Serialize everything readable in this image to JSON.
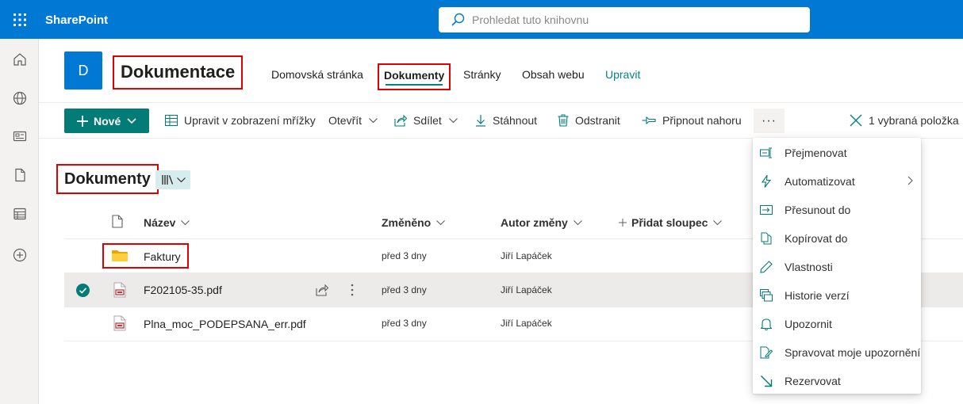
{
  "app": {
    "name": "SharePoint"
  },
  "search": {
    "placeholder": "Prohledat tuto knihovnu"
  },
  "site": {
    "logo_letter": "D",
    "title": "Dokumentace"
  },
  "nav": {
    "items": [
      "Domovská stránka",
      "Dokumenty",
      "Stránky",
      "Obsah webu",
      "Upravit"
    ],
    "active": "Dokumenty"
  },
  "commands": {
    "new": "Nové",
    "grid_edit": "Upravit v zobrazení mřížky",
    "open": "Otevřít",
    "share": "Sdílet",
    "download": "Stáhnout",
    "delete": "Odstranit",
    "pin": "Připnout nahoru",
    "more": "···",
    "selected": "1 vybraná položka"
  },
  "library": {
    "title": "Dokumenty"
  },
  "columns": {
    "name": "Název",
    "modified": "Změněno",
    "author": "Autor změny",
    "add": "Přidat sloupec"
  },
  "files": [
    {
      "name": "Faktury",
      "type": "folder",
      "modified": "před 3 dny",
      "author": "Jiří Lapáček",
      "selected": false
    },
    {
      "name": "F202105-35.pdf",
      "type": "pdf",
      "modified": "před 3 dny",
      "author": "Jiří Lapáček",
      "selected": true
    },
    {
      "name": "Plna_moc_PODEPSANA_err.pdf",
      "type": "pdf",
      "modified": "před 3 dny",
      "author": "Jiří Lapáček",
      "selected": false
    }
  ],
  "context_menu": {
    "items": [
      "Přejmenovat",
      "Automatizovat",
      "Přesunout do",
      "Kopírovat do",
      "Vlastnosti",
      "Historie verzí",
      "Upozornit",
      "Spravovat moje upozornění",
      "Rezervovat"
    ],
    "icons": [
      "rename-icon",
      "automate-icon",
      "move-icon",
      "copy-icon",
      "properties-icon",
      "version-history-icon",
      "alert-icon",
      "manage-alerts-icon",
      "checkout-icon"
    ]
  },
  "colors": {
    "brand": "#0078d4",
    "accent": "#038387",
    "highlight": "#e00000"
  }
}
